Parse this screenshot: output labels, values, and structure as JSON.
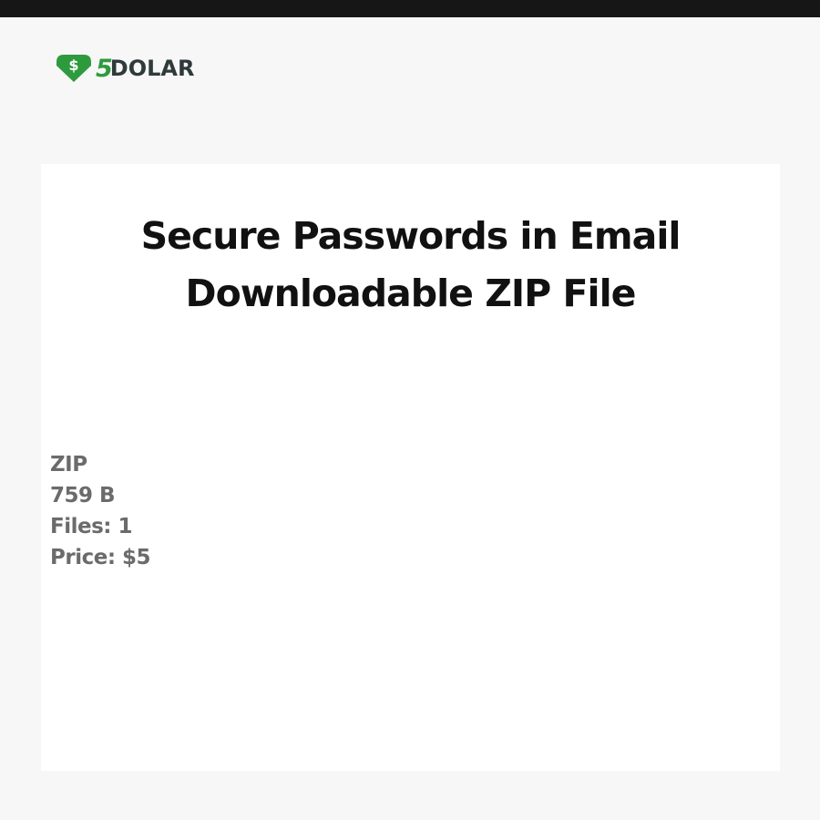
{
  "header": {
    "logo": {
      "digit": "5",
      "word": "DOLAR",
      "icon": "dollar-download-icon",
      "brand_color": "#2e9a3e",
      "text_color": "#2f3a3a"
    },
    "bar_color": "#161616"
  },
  "product": {
    "title_line1": "Secure Passwords in Email",
    "title_line2": "Downloadable ZIP File",
    "format": "ZIP",
    "size": "759 B",
    "files": "Files: 1",
    "price": "Price: $5"
  }
}
